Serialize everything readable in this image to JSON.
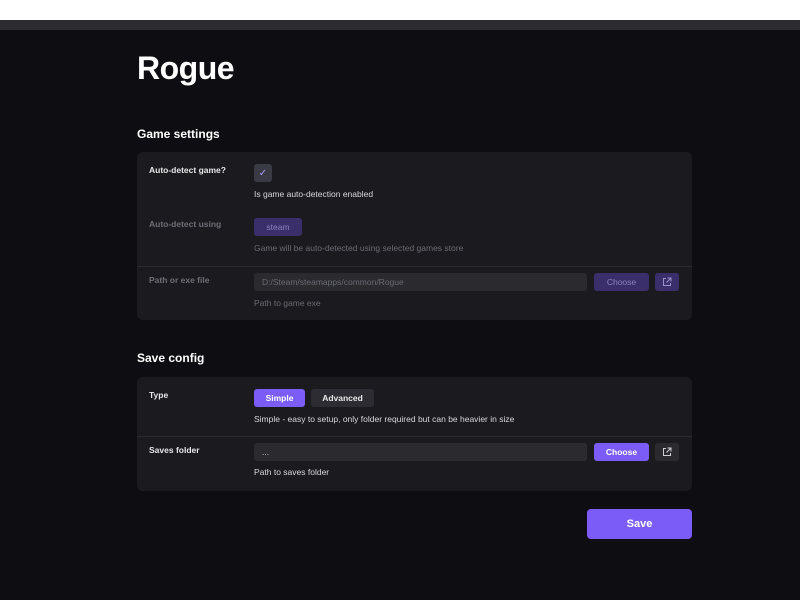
{
  "page": {
    "title": "Rogue"
  },
  "game_settings": {
    "title": "Game settings",
    "auto_detect": {
      "label": "Auto-detect game?",
      "checked": true,
      "description": "Is game auto-detection enabled"
    },
    "auto_detect_using": {
      "label": "Auto-detect using",
      "value": "steam",
      "description": "Game will be auto-detected using selected games store"
    },
    "path": {
      "label": "Path or exe file",
      "value": "D:/Steam/steamapps/common/Rogue",
      "choose_label": "Choose",
      "description": "Path to game exe"
    }
  },
  "save_config": {
    "title": "Save config",
    "type": {
      "label": "Type",
      "options": [
        "Simple",
        "Advanced"
      ],
      "selected": "Simple",
      "description": "Simple - easy to setup, only folder required but can be heavier in size"
    },
    "saves_folder": {
      "label": "Saves folder",
      "value": "...",
      "choose_label": "Choose",
      "description": "Path to saves folder"
    }
  },
  "actions": {
    "save_label": "Save"
  },
  "colors": {
    "accent": "#7b5cf6",
    "accent_disabled": "#3a2f6b",
    "background": "#0e0e12",
    "card": "#1b1b1f"
  },
  "icons": {
    "check": "check-icon",
    "external_link": "external-link-icon"
  }
}
